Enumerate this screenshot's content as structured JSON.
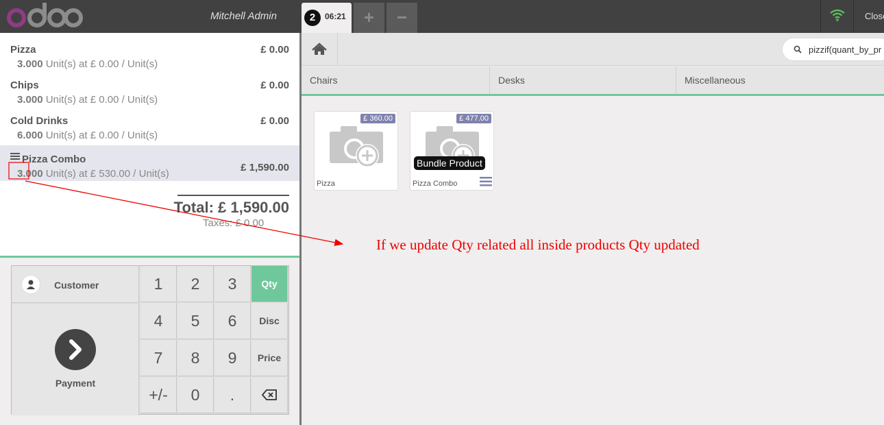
{
  "header": {
    "brand": "odoo",
    "user": "Mitchell Admin",
    "order_number": "2",
    "order_time": "06:21",
    "add_order_label": "+",
    "remove_order_label": "−",
    "close_label": "Close"
  },
  "orderlines": [
    {
      "name": "Pizza",
      "qty": "3.000",
      "detail": "Unit(s) at £ 0.00 / Unit(s)",
      "price": "£ 0.00",
      "selected": false
    },
    {
      "name": "Chips",
      "qty": "3.000",
      "detail": "Unit(s) at £ 0.00 / Unit(s)",
      "price": "£ 0.00",
      "selected": false
    },
    {
      "name": "Cold Drinks",
      "qty": "6.000",
      "detail": "Unit(s) at £ 0.00 / Unit(s)",
      "price": "£ 0.00",
      "selected": false
    },
    {
      "name": "Pizza Combo",
      "qty": "3.000",
      "detail": "Unit(s) at £ 530.00 / Unit(s)",
      "price": "£ 1,590.00",
      "selected": true
    }
  ],
  "summary": {
    "total": "Total: £ 1,590.00",
    "taxes": "Taxes: £ 0.00"
  },
  "actionpad": {
    "customer_label": "Customer",
    "payment_label": "Payment"
  },
  "numpad": {
    "keys": [
      "1",
      "2",
      "3",
      "Qty",
      "4",
      "5",
      "6",
      "Disc",
      "7",
      "8",
      "9",
      "Price",
      "+/-",
      "0",
      ".",
      "backspace-icon"
    ],
    "active_mode": "Qty"
  },
  "search": {
    "value": "pizzif(quant_by_pr"
  },
  "categories": [
    "Chairs",
    "Desks",
    "Miscellaneous"
  ],
  "products": [
    {
      "name": "Pizza",
      "price": "£ 360.00",
      "badge": ""
    },
    {
      "name": "Pizza Combo",
      "price": "£ 477.00",
      "badge": "Bundle Product"
    }
  ],
  "annotation": {
    "text": "If we update Qty related all inside products Qty updated",
    "color": "#e00000"
  },
  "colors": {
    "accent": "#6ec89b",
    "header_bg": "#414141",
    "price_tag": "#7f82ac",
    "brand_purple": "#8f3c83"
  }
}
